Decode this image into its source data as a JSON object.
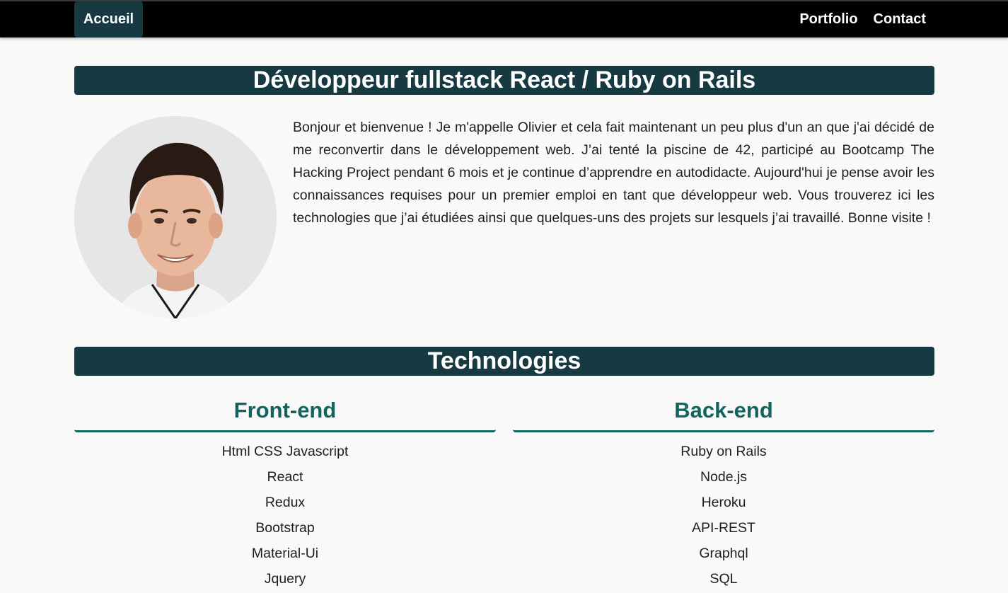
{
  "nav": {
    "home": "Accueil",
    "links": [
      "Portfolio",
      "Contact"
    ]
  },
  "intro": {
    "title": "Développeur fullstack React / Ruby on Rails",
    "text": "Bonjour et bienvenue ! Je m'appelle Olivier et cela fait maintenant un peu plus d'un an que j'ai décidé de me reconvertir dans le développement web. J’ai tenté la piscine de 42, participé au Bootcamp The Hacking Project pendant 6 mois et je continue d’apprendre en autodidacte. Aujourd'hui je pense avoir les connaissances requises pour un premier emploi en tant que développeur web. Vous trouverez ici les technologies que j’ai étudiées ainsi que quelques-uns des projets sur lesquels j’ai travaillé. Bonne visite !"
  },
  "technologies": {
    "title": "Technologies",
    "front": {
      "title": "Front-end",
      "items": [
        "Html CSS Javascript",
        "React",
        "Redux",
        "Bootstrap",
        "Material-Ui",
        "Jquery"
      ]
    },
    "back": {
      "title": "Back-end",
      "items": [
        "Ruby on Rails",
        "Node.js",
        "Heroku",
        "API-REST",
        "Graphql",
        "SQL"
      ]
    }
  },
  "colors": {
    "navbar": "#000000",
    "accent_dark": "#173a42",
    "accent_teal": "#13645f",
    "background": "#f9f9f9"
  }
}
